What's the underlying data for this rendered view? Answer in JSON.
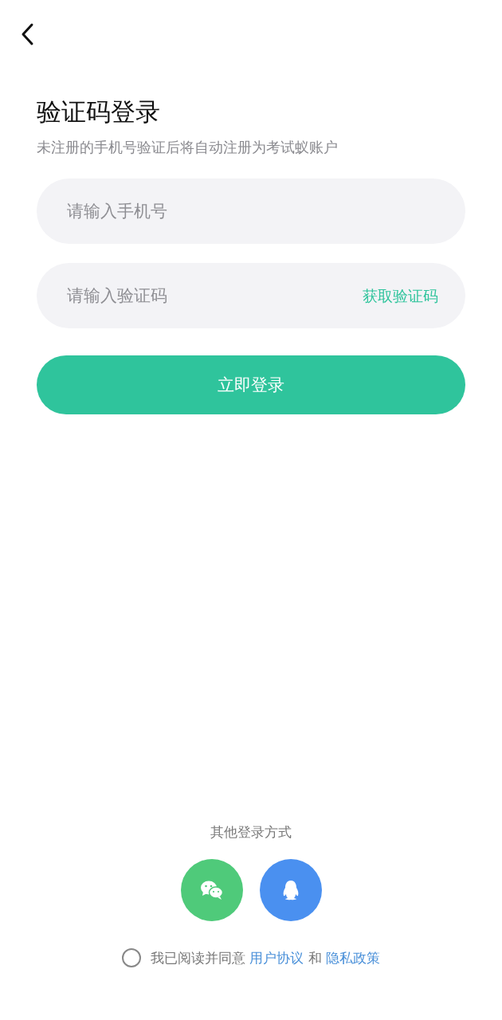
{
  "title": "验证码登录",
  "subtitle": "未注册的手机号验证后将自动注册为考试蚁账户",
  "phone_field": {
    "placeholder": "请输入手机号"
  },
  "code_field": {
    "placeholder": "请输入验证码",
    "action": "获取验证码"
  },
  "login_button": "立即登录",
  "other_login": {
    "label": "其他登录方式",
    "options": [
      {
        "kind": "chat",
        "color": "#4fca7a"
      },
      {
        "kind": "penguin",
        "color": "#4a90f0"
      }
    ]
  },
  "agreement": {
    "checked": false,
    "prefix": "我已阅读并同意",
    "link_1": "用户协议",
    "joiner": "和",
    "link_2": "隐私政策"
  }
}
